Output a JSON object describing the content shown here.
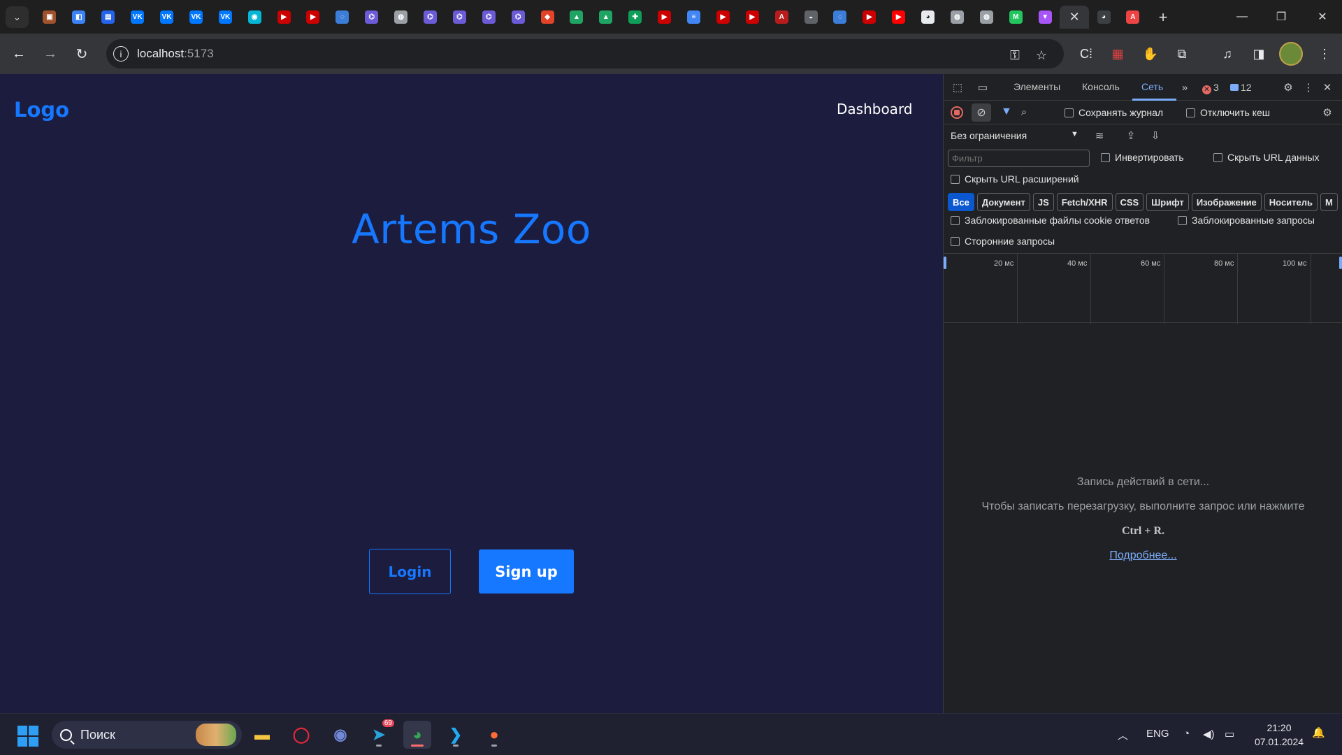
{
  "browser": {
    "tabs": [
      {
        "icon": "generic-favicon-icon",
        "color": "#a0522d",
        "glyph": "▣"
      },
      {
        "icon": "pinned-app-icon",
        "color": "#3b82f6",
        "glyph": "◧"
      },
      {
        "icon": "chat-icon",
        "color": "#2563eb",
        "glyph": "▤"
      },
      {
        "icon": "vk-icon",
        "color": "#0077ff",
        "glyph": "VK"
      },
      {
        "icon": "vk-icon",
        "color": "#0077ff",
        "glyph": "VK"
      },
      {
        "icon": "vk-icon",
        "color": "#0077ff",
        "glyph": "VK"
      },
      {
        "icon": "vk-icon",
        "color": "#0077ff",
        "glyph": "VK"
      },
      {
        "icon": "messenger-icon",
        "color": "#06b6d4",
        "glyph": "◉"
      },
      {
        "icon": "youtube-icon",
        "color": "#cc0000",
        "glyph": "▶"
      },
      {
        "icon": "youtube-icon",
        "color": "#cc0000",
        "glyph": "▶"
      },
      {
        "icon": "svelte-icon",
        "color": "#3b7dd8",
        "glyph": "◌"
      },
      {
        "icon": "graph-icon",
        "color": "#6b5bd6",
        "glyph": "⌬"
      },
      {
        "icon": "globe-icon",
        "color": "#9aa0a6",
        "glyph": "◍"
      },
      {
        "icon": "graph-icon",
        "color": "#6b5bd6",
        "glyph": "⌬"
      },
      {
        "icon": "graph-icon",
        "color": "#6b5bd6",
        "glyph": "⌬"
      },
      {
        "icon": "graph-icon",
        "color": "#6b5bd6",
        "glyph": "⌬"
      },
      {
        "icon": "graph-icon",
        "color": "#6b5bd6",
        "glyph": "⌬"
      },
      {
        "icon": "gitlab-icon",
        "color": "#e24329",
        "glyph": "◆"
      },
      {
        "icon": "google-drive-icon",
        "color": "#1fa463",
        "glyph": "▲"
      },
      {
        "icon": "google-drive-icon",
        "color": "#1fa463",
        "glyph": "▲"
      },
      {
        "icon": "google-sheets-icon",
        "color": "#0f9d58",
        "glyph": "✚"
      },
      {
        "icon": "youtube-icon",
        "color": "#cc0000",
        "glyph": "▶"
      },
      {
        "icon": "google-docs-icon",
        "color": "#4285f4",
        "glyph": "≡"
      },
      {
        "icon": "youtube-icon",
        "color": "#cc0000",
        "glyph": "▶"
      },
      {
        "icon": "youtube-icon",
        "color": "#cc0000",
        "glyph": "▶"
      },
      {
        "icon": "pdf-icon",
        "color": "#b91c1c",
        "glyph": "A"
      },
      {
        "icon": "generic-favicon-icon",
        "color": "#5f6368",
        "glyph": "◒"
      },
      {
        "icon": "svelte-icon",
        "color": "#3b7dd8",
        "glyph": "◌"
      },
      {
        "icon": "youtube-icon",
        "color": "#cc0000",
        "glyph": "▶"
      },
      {
        "icon": "youtube-icon",
        "color": "#ff0000",
        "glyph": "▶"
      },
      {
        "icon": "github-icon",
        "color": "#e8eaed",
        "glyph": "◕"
      },
      {
        "icon": "globe-icon",
        "color": "#9aa0a6",
        "glyph": "◍"
      },
      {
        "icon": "globe-icon",
        "color": "#9aa0a6",
        "glyph": "◍"
      },
      {
        "icon": "m-logo-icon",
        "color": "#22c55e",
        "glyph": "M"
      },
      {
        "icon": "vite-icon",
        "color": "#a855f7",
        "glyph": "▼"
      },
      {
        "icon": "close-icon",
        "active": true,
        "glyph": "✕"
      },
      {
        "icon": "github-icon",
        "color": "#3c4043",
        "glyph": "◕"
      },
      {
        "icon": "pdf-icon",
        "color": "#ef4444",
        "glyph": "A"
      }
    ],
    "new_tab_glyph": "+",
    "url_host": "localhost",
    "url_port": ":5173"
  },
  "site": {
    "logo": "Logo",
    "nav_dashboard": "Dashboard",
    "title": "Artems Zoo",
    "login_label": "Login",
    "signup_label": "Sign up",
    "colors": {
      "background": "#1c1c3e",
      "accent": "#1677ff"
    }
  },
  "devtools": {
    "tabs": {
      "elements": "Элементы",
      "console": "Консоль",
      "network": "Сеть"
    },
    "error_count": "3",
    "message_count": "12",
    "preserve_log": "Сохранять журнал",
    "disable_cache": "Отключить кеш",
    "throttling": "Без ограничения",
    "filter_placeholder": "Фильтр",
    "invert": "Инвертировать",
    "hide_data_urls": "Скрыть URL данных",
    "hide_extension_urls": "Скрыть URL расширений",
    "resource_types": [
      "Все",
      "Документ",
      "JS",
      "Fetch/XHR",
      "CSS",
      "Шрифт",
      "Изображение",
      "Носитель",
      "М"
    ],
    "blocked_cookies": "Заблокированные файлы cookie ответов",
    "blocked_requests": "Заблокированные запросы",
    "third_party": "Сторонние запросы",
    "timeline_ticks": [
      "20 мс",
      "40 мс",
      "60 мс",
      "80 мс",
      "100 мс"
    ],
    "empty_line1": "Запись действий в сети...",
    "empty_line2": "Чтобы записать перезагрузку, выполните запрос или нажмите",
    "empty_shortcut": "Ctrl + R.",
    "empty_link": "Подробнее..."
  },
  "taskbar": {
    "search_label": "Поиск",
    "telegram_badge": "69",
    "language": "ENG",
    "time": "21:20",
    "date": "07.01.2024"
  }
}
